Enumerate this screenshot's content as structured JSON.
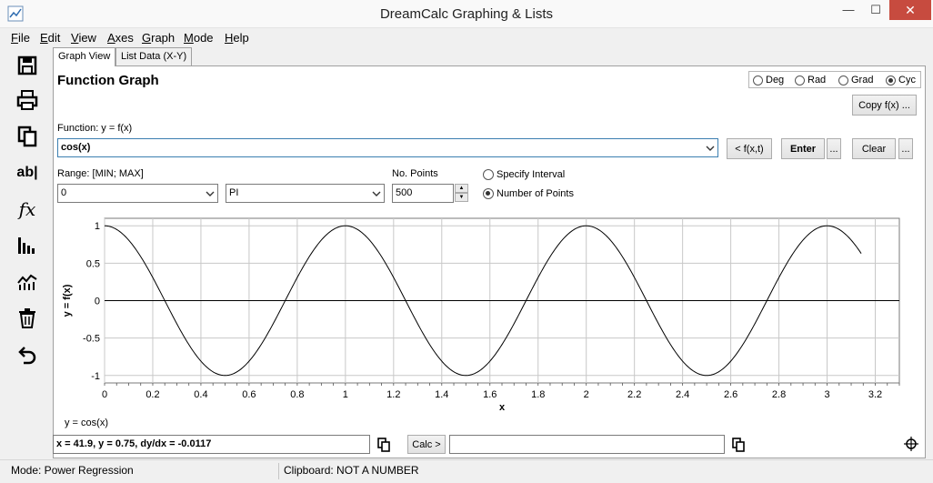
{
  "window": {
    "title": "DreamCalc Graphing & Lists",
    "app_icon": "chart-line-icon",
    "controls": {
      "minimize": "—",
      "maximize": "☐",
      "close": "✕"
    }
  },
  "menu": [
    {
      "label": "File",
      "u": "F",
      "rest": "ile"
    },
    {
      "label": "Edit",
      "u": "E",
      "rest": "dit"
    },
    {
      "label": "View",
      "u": "V",
      "rest": "iew"
    },
    {
      "label": "Axes",
      "u": "A",
      "rest": "xes"
    },
    {
      "label": "Graph",
      "u": "G",
      "rest": "raph"
    },
    {
      "label": "Mode",
      "u": "M",
      "rest": "ode"
    },
    {
      "label": "Help",
      "u": "H",
      "rest": "elp"
    }
  ],
  "toolbar": [
    "save-icon",
    "print-icon",
    "copy-icon",
    "text-label-icon",
    "function-icon",
    "bar-chart-icon",
    "trend-chart-icon",
    "delete-icon",
    "undo-icon"
  ],
  "toolbar_glyphs": {
    "text_label": "ab|",
    "function": "𝑓x"
  },
  "tabs": [
    {
      "label": "Graph View",
      "active": true
    },
    {
      "label": "List Data (X-Y)",
      "active": false
    }
  ],
  "panel": {
    "title": "Function Graph",
    "angle_units": [
      {
        "label": "Deg",
        "selected": false
      },
      {
        "label": "Rad",
        "selected": false
      },
      {
        "label": "Grad",
        "selected": false
      },
      {
        "label": "Cyc",
        "selected": true
      }
    ],
    "copy_fx_label": "Copy f(x) ...",
    "function_label": "Function: y = f(x)",
    "function_value": "cos(x)",
    "fxt_button": "< f(x,t)",
    "enter_button": "Enter",
    "ellipsis_button": "...",
    "clear_button": "Clear",
    "range_label": "Range: [MIN; MAX]",
    "range_min": "0",
    "range_max": "PI",
    "points_label": "No. Points",
    "points_value": "500",
    "interval_options": [
      {
        "label": "Specify Interval",
        "selected": false
      },
      {
        "label": "Number of Points",
        "selected": true
      }
    ]
  },
  "chart_data": {
    "type": "line",
    "title": "",
    "xlabel": "x",
    "ylabel": "y = f(x)",
    "xlim": [
      0,
      3.3
    ],
    "ylim": [
      -1.1,
      1.1
    ],
    "x_ticks": [
      0,
      0.2,
      0.4,
      0.6,
      0.8,
      1,
      1.2,
      1.4,
      1.6,
      1.8,
      2,
      2.2,
      2.4,
      2.6,
      2.8,
      3,
      3.2
    ],
    "x_tick_labels": [
      "0",
      "0.2",
      "0.4",
      "0.6",
      "0.8",
      "1",
      "1.2",
      "1.4",
      "1.6",
      "1.8",
      "2",
      "2.2",
      "2.4",
      "2.6",
      "2.8",
      "3",
      "3.2"
    ],
    "y_ticks": [
      -1,
      -0.5,
      0,
      0.5,
      1
    ],
    "y_tick_labels": [
      "-1",
      "-0.5",
      "0",
      "0.5",
      "1"
    ],
    "grid": true,
    "series": [
      {
        "name": "y = cos(x)",
        "function": "cos(2πx)",
        "x_range": [
          0,
          3.14159
        ],
        "points": 500,
        "color": "#000000"
      }
    ],
    "legend": "y = cos(x)"
  },
  "coords": {
    "readout": "x = 41.9, y = 0.75, dy/dx = -0.0117",
    "calc_button": "Calc >",
    "calc_value": ""
  },
  "status": {
    "mode": "Mode: Power Regression",
    "clipboard": "Clipboard: NOT A NUMBER"
  }
}
